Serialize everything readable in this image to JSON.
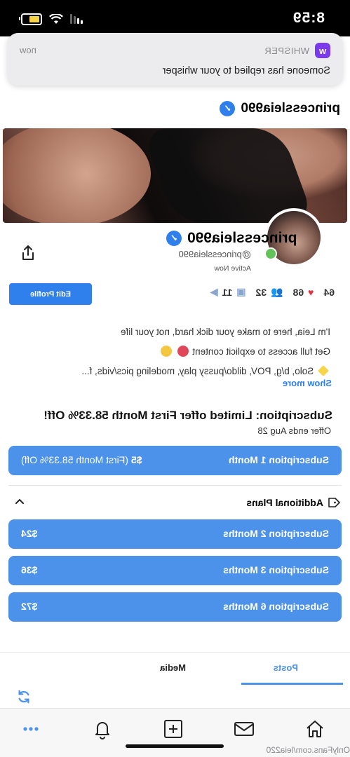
{
  "status_bar": {
    "time": "8:59"
  },
  "notification": {
    "app_name": "WHISPER",
    "app_icon_letter": "w",
    "time": "now",
    "message": "Someone has replied to your whisper"
  },
  "header": {
    "title": "princessleia990"
  },
  "profile": {
    "name": "princessleia990",
    "handle": "@princessleia990",
    "status": "Active Now",
    "edit_label": "Edit Profile",
    "stats": {
      "posts": "64",
      "likes": "68",
      "photos": "32",
      "videos": "11"
    }
  },
  "bio": {
    "line1": "I'm Leia, here to make your dick hard, not your life",
    "line2": "Get full access to explicit content",
    "line3": "Solo, b/g, POV, dildo/pussy play, modeling pics/vids, f...",
    "show_more": "Show more"
  },
  "subscription": {
    "title": "Subscription: Limited offer First Month 58.33% Off!",
    "offer_ends": "Offer ends Aug 28",
    "primary": {
      "label": "Subscription 1 Month",
      "price": "$5",
      "note": "(First Month 58.33% Off)"
    }
  },
  "plans": {
    "title": "Additional Plans",
    "items": [
      {
        "label": "Subscription 2 Months",
        "price": "$24"
      },
      {
        "label": "Subscription 3 Months",
        "price": "$36"
      },
      {
        "label": "Subscription 6 Months",
        "price": "$72"
      }
    ]
  },
  "tabs": {
    "posts": "Posts",
    "media": "Media"
  },
  "footer": {
    "url": "OnlyFans.com/leia220"
  },
  "colors": {
    "accent": "#2f80ed",
    "button": "#4c92ea",
    "online": "#61c35a",
    "heart": "#e3343f"
  }
}
